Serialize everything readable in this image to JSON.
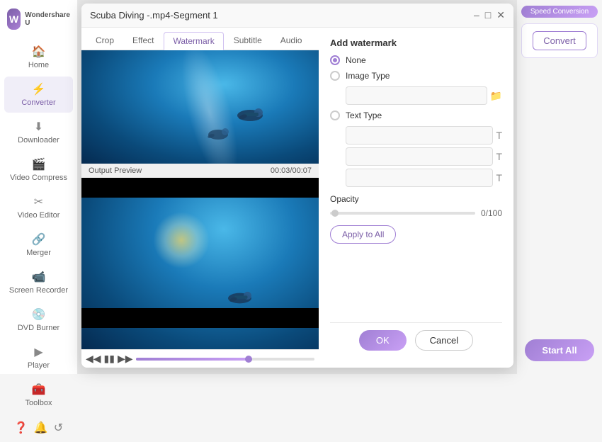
{
  "app": {
    "name": "Wondershare U",
    "logo_letter": "W"
  },
  "sidebar": {
    "items": [
      {
        "id": "home",
        "label": "Home",
        "icon": "🏠"
      },
      {
        "id": "converter",
        "label": "Converter",
        "icon": "⚡",
        "active": true
      },
      {
        "id": "downloader",
        "label": "Downloader",
        "icon": "⬇"
      },
      {
        "id": "video-compress",
        "label": "Video Compress",
        "icon": "🎬"
      },
      {
        "id": "video-editor",
        "label": "Video Editor",
        "icon": "✂"
      },
      {
        "id": "merger",
        "label": "Merger",
        "icon": "🔗"
      },
      {
        "id": "screen-recorder",
        "label": "Screen Recorder",
        "icon": "📹"
      },
      {
        "id": "dvd-burner",
        "label": "DVD Burner",
        "icon": "💿"
      },
      {
        "id": "player",
        "label": "Player",
        "icon": "▶"
      },
      {
        "id": "toolbox",
        "label": "Toolbox",
        "icon": "🧰"
      }
    ],
    "bottom_icons": [
      "?",
      "🔔",
      "↺"
    ]
  },
  "dialog": {
    "title": "Scuba Diving -.mp4-Segment 1",
    "tabs": [
      {
        "id": "crop",
        "label": "Crop"
      },
      {
        "id": "effect",
        "label": "Effect"
      },
      {
        "id": "watermark",
        "label": "Watermark",
        "active": true
      },
      {
        "id": "subtitle",
        "label": "Subtitle"
      },
      {
        "id": "audio",
        "label": "Audio"
      }
    ],
    "output_preview_label": "Output Preview",
    "timecode": "00:03/00:07",
    "watermark": {
      "title": "Add watermark",
      "options": [
        {
          "id": "none",
          "label": "None",
          "selected": true
        },
        {
          "id": "image",
          "label": "Image Type",
          "selected": false
        },
        {
          "id": "text",
          "label": "Text Type",
          "selected": false
        }
      ],
      "image_placeholder": "",
      "text_inputs": [
        "",
        "",
        ""
      ],
      "opacity_label": "Opacity",
      "opacity_value": "0/100",
      "apply_btn_label": "Apply to All"
    },
    "footer": {
      "ok_label": "OK",
      "cancel_label": "Cancel"
    }
  },
  "right_panel": {
    "speed_label": "Speed Conversion",
    "convert_label": "Convert",
    "start_all_label": "Start All"
  }
}
